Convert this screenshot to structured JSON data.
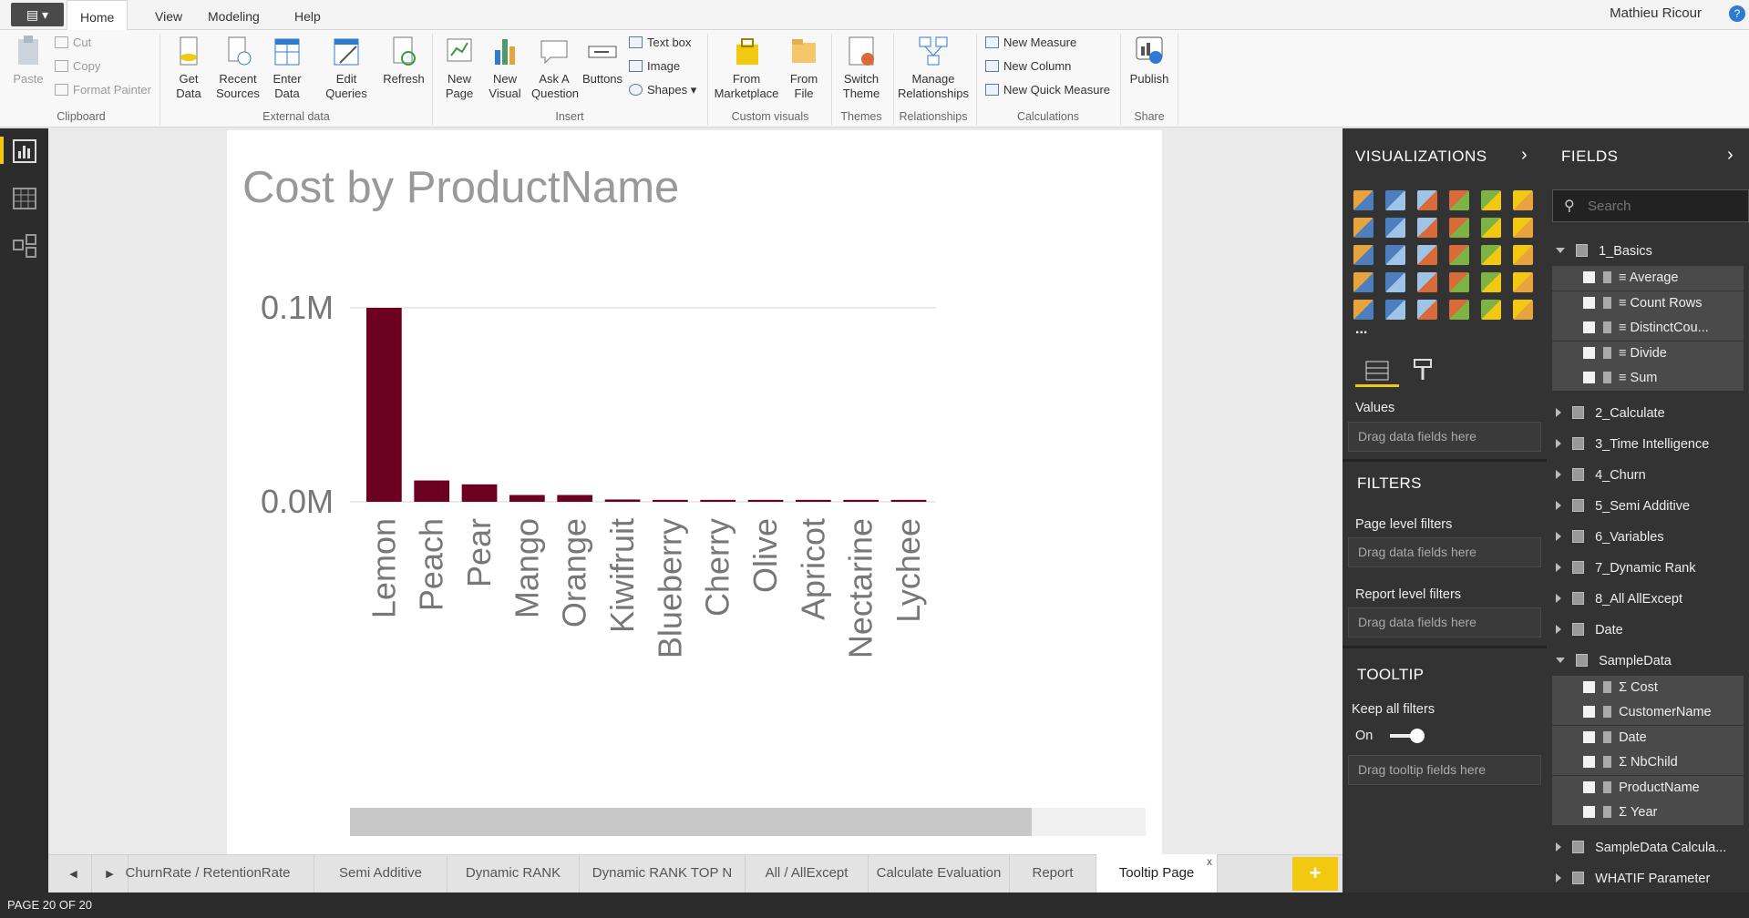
{
  "ribbon": {
    "tabs": [
      "Home",
      "View",
      "Modeling",
      "Help"
    ],
    "user": "Mathieu Ricour",
    "clipboard": {
      "paste": "Paste",
      "cut": "Cut",
      "copy": "Copy",
      "format_painter": "Format Painter",
      "label": "Clipboard"
    },
    "external": {
      "get_data": "Get\nData",
      "recent": "Recent\nSources",
      "enter": "Enter\nData",
      "edit": "Edit\nQueries",
      "refresh": "Refresh",
      "label": "External data"
    },
    "insert": {
      "new_page": "New\nPage",
      "new_visual": "New\nVisual",
      "ask": "Ask A\nQuestion",
      "buttons": "Buttons",
      "text_box": "Text box",
      "image": "Image",
      "shapes": "Shapes",
      "label": "Insert"
    },
    "custom": {
      "marketplace": "From\nMarketplace",
      "file": "From\nFile",
      "label": "Custom visuals"
    },
    "themes": {
      "switch": "Switch\nTheme",
      "label": "Themes"
    },
    "relationships": {
      "manage": "Manage\nRelationships",
      "label": "Relationships"
    },
    "calculations": {
      "new_measure": "New Measure",
      "new_column": "New Column",
      "new_quick": "New Quick Measure",
      "label": "Calculations"
    },
    "share": {
      "publish": "Publish",
      "label": "Share"
    }
  },
  "chart_data": {
    "type": "bar",
    "title": "Cost by ProductName",
    "categories": [
      "Lemon",
      "Peach",
      "Pear",
      "Mango",
      "Orange",
      "Kiwifruit",
      "Blueberry",
      "Cherry",
      "Olive",
      "Apricot",
      "Nectarine",
      "Lychee"
    ],
    "values": [
      100000,
      11000,
      9000,
      3500,
      3500,
      1200,
      1000,
      1000,
      1000,
      1000,
      1000,
      1000
    ],
    "ticks": [
      "0.0M",
      "0.1M"
    ],
    "tick_values": [
      0,
      100000
    ],
    "ylim": [
      0,
      100000
    ],
    "bar_color": "#6b0020",
    "grid": true,
    "xlabel": "",
    "ylabel": ""
  },
  "page_tabs": [
    "ChurnRate / RetentionRate",
    "Semi Additive",
    "Dynamic RANK",
    "Dynamic RANK TOP N",
    "All / AllExcept",
    "Calculate Evaluation",
    "Report",
    "Tooltip Page"
  ],
  "active_tab": "Tooltip Page",
  "status": "PAGE 20 OF 20",
  "viz": {
    "title": "VISUALIZATIONS",
    "more": "...",
    "values_label": "Values",
    "drag": "Drag data fields here",
    "filters_title": "FILTERS",
    "page_filters": "Page level filters",
    "report_filters": "Report level filters",
    "tooltip_title": "TOOLTIP",
    "keep_filters": "Keep all filters",
    "toggle_state": "On",
    "drag_tooltip": "Drag tooltip fields here",
    "icon_colors": [
      "#e8a33c",
      "#4d7fbf",
      "#9ec5e8",
      "#d96b3b",
      "#7cb342",
      "#f2c811"
    ]
  },
  "fields": {
    "title": "FIELDS",
    "search_placeholder": "Search",
    "tables": [
      {
        "name": "1_Basics",
        "open": true,
        "items": [
          "≡ Average",
          "≡ Count Rows",
          "≡ DistinctCou...",
          "≡ Divide",
          "≡ Sum"
        ]
      },
      {
        "name": "2_Calculate"
      },
      {
        "name": "3_Time Intelligence"
      },
      {
        "name": "4_Churn"
      },
      {
        "name": "5_Semi Additive"
      },
      {
        "name": "6_Variables"
      },
      {
        "name": "7_Dynamic Rank"
      },
      {
        "name": "8_All AllExcept"
      },
      {
        "name": "Date"
      },
      {
        "name": "SampleData",
        "open": true,
        "items": [
          "Σ Cost",
          "CustomerName",
          "Date",
          "Σ NbChild",
          "ProductName",
          "Σ Year"
        ]
      },
      {
        "name": "SampleData Calcula..."
      },
      {
        "name": "WHATIF Parameter"
      }
    ]
  }
}
